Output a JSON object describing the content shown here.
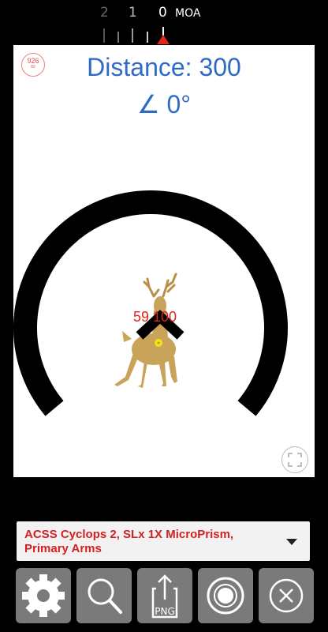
{
  "ruler": {
    "labels": [
      "2",
      "1",
      "0"
    ],
    "unit": "MOA"
  },
  "scope": {
    "badge_main": "926",
    "badge_sub": "82",
    "distance": "Distance: 300",
    "angle": "∠ 0°",
    "hit_readout": "59  100",
    "target_icon": "deer-target-icon",
    "reticle_color": "#000000"
  },
  "optic": {
    "selected": "ACSS Cyclops 2, SLx 1X MicroPrism, Primary Arms"
  },
  "toolbar": {
    "buttons": [
      "settings",
      "zoom",
      "export-png",
      "shoot",
      "close"
    ],
    "png_label": "PNG"
  },
  "colors": {
    "accent_blue": "#2f6bc4",
    "accent_red": "#e0241b",
    "tool_gray": "#7a7a7a"
  }
}
